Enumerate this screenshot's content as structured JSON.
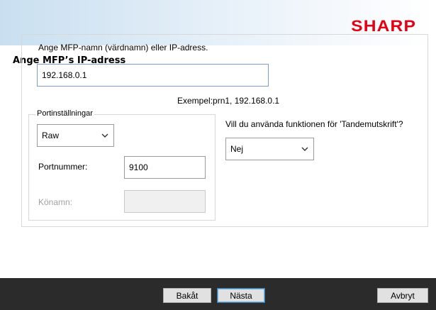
{
  "header": {
    "brand": "SHARP"
  },
  "page": {
    "title": "Ange MFP’s IP-adress"
  },
  "address": {
    "prompt": "Ange MFP-namn (värdnamn) eller IP-adress.",
    "value": "192.168.0.1",
    "example": "Exempel:prn1, 192.168.0.1"
  },
  "port_settings": {
    "legend": "Portinställningar",
    "protocol": "Raw",
    "port_label": "Portnummer:",
    "port_value": "9100",
    "queue_label": "Könamn:",
    "queue_value": ""
  },
  "tandem": {
    "question": "Vill du använda funktionen för 'Tandemutskrift'?",
    "value": "Nej"
  },
  "buttons": {
    "back": "Bakåt",
    "next": "Nästa",
    "cancel": "Avbryt"
  },
  "icons": {
    "dropdown": "chevron-down-icon"
  }
}
